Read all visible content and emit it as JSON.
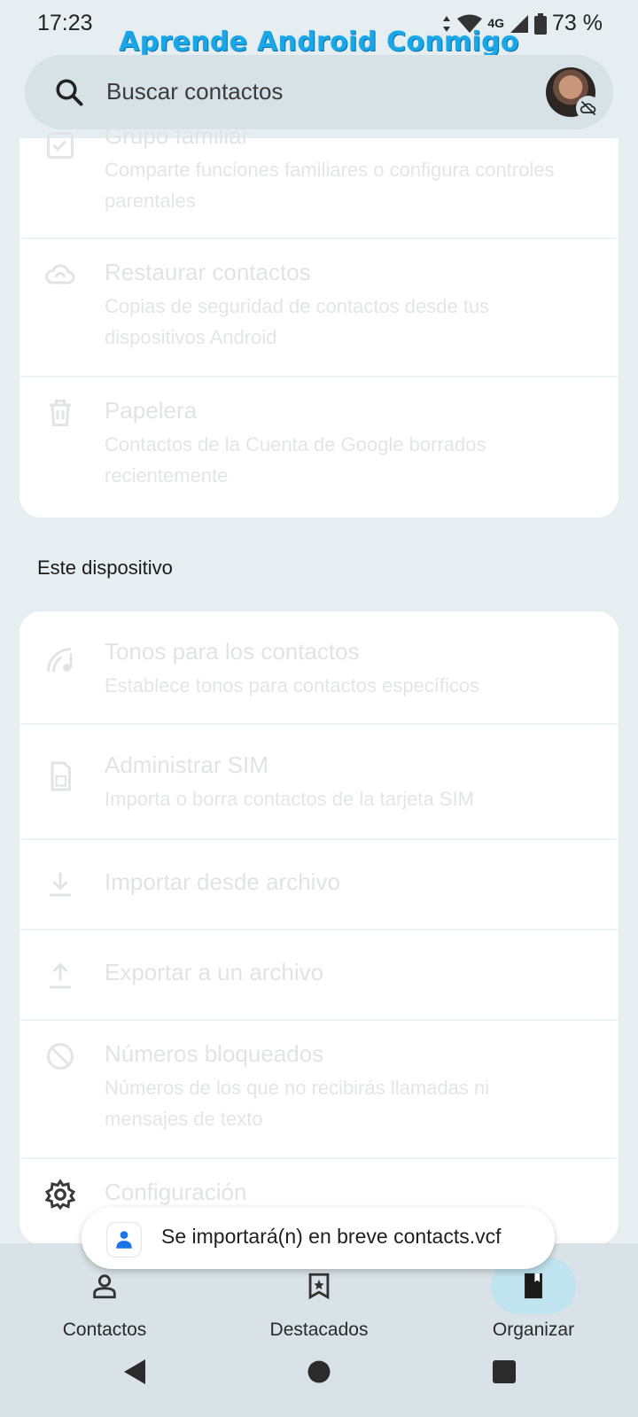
{
  "status_bar": {
    "time": "17:23",
    "network": "4G",
    "battery": "73 %",
    "icons": [
      "data-arrows-icon",
      "wifi-icon",
      "signal-icon",
      "battery-icon"
    ]
  },
  "watermark": "Aprende Android Conmigo",
  "search": {
    "placeholder": "Buscar contactos",
    "avatar_badge_icon": "backup-off-icon"
  },
  "cards": {
    "google": [
      {
        "title": "Grupo familiar",
        "subtitle": "Comparte funciones familiares o configura controles parentales",
        "icon": "family-icon"
      },
      {
        "title": "Restaurar contactos",
        "subtitle": "Copias de seguridad de contactos desde tus dispositivos Android",
        "icon": "cloud-sync-icon"
      },
      {
        "title": "Papelera",
        "subtitle": "Contactos de la Cuenta de Google borrados recientemente",
        "icon": "trash-icon"
      }
    ],
    "device_section_label": "Este dispositivo",
    "device": [
      {
        "title": "Tonos para los contactos",
        "subtitle": "Establece tonos para contactos específicos",
        "icon": "ringtone-icon"
      },
      {
        "title": "Administrar SIM",
        "subtitle": "Importa o borra contactos de la tarjeta SIM",
        "icon": "sim-card-icon"
      },
      {
        "title": "Importar desde archivo",
        "subtitle": "",
        "icon": "download-icon"
      },
      {
        "title": "Exportar a un archivo",
        "subtitle": "",
        "icon": "upload-icon"
      },
      {
        "title": "Números bloqueados",
        "subtitle": "Números de los que no recibirás llamadas ni mensajes de texto",
        "icon": "block-icon"
      },
      {
        "title": "Configuración",
        "subtitle": "",
        "icon": "settings-icon"
      }
    ]
  },
  "toast": {
    "message": "Se importará(n) en breve contacts.vcf",
    "icon": "contacts-app-icon"
  },
  "bottom_nav": {
    "items": [
      {
        "label": "Contactos",
        "icon": "person-icon",
        "active": false
      },
      {
        "label": "Destacados",
        "icon": "star-icon",
        "active": false
      },
      {
        "label": "Organizar",
        "icon": "bookmark-icon",
        "active": true
      }
    ]
  },
  "colors": {
    "background": "#e6eef1",
    "accent": "#bfe3ef",
    "watermark": "#19a7e8"
  }
}
